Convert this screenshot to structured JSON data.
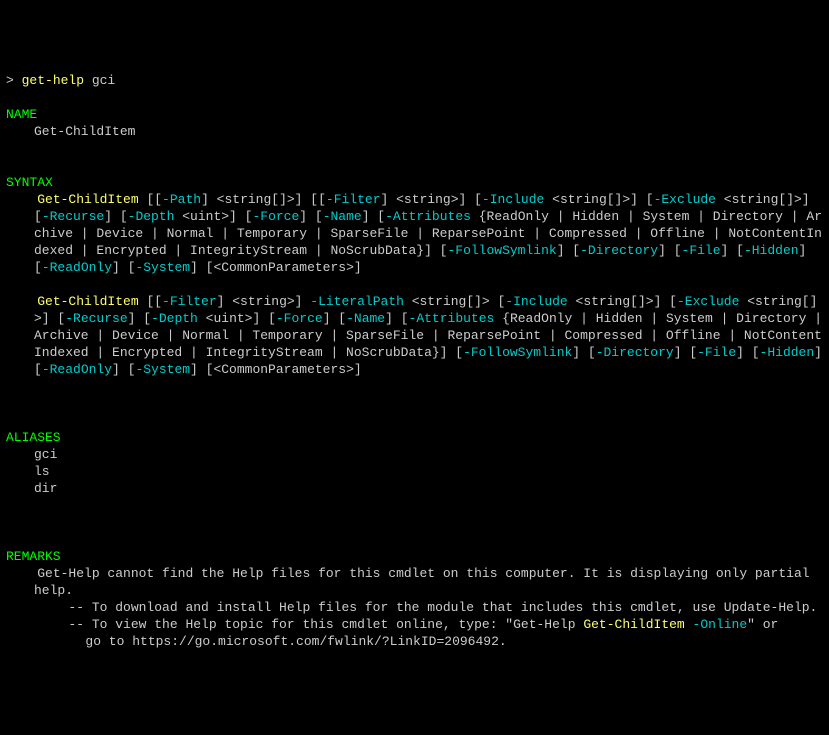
{
  "prompt": {
    "symbol": "> ",
    "command": "get-help ",
    "arg": "gci"
  },
  "sections": {
    "name": {
      "header": "NAME",
      "value": "Get-ChildItem"
    },
    "syntax": {
      "header": "SYNTAX",
      "sig1": {
        "cmd": "Get-ChildItem",
        "path_lb": " [[",
        "path": "-Path",
        "path_rb": "] <string[]>] [[",
        "filter": "-Filter",
        "filter_rb": "] <string>] [",
        "include": "-Include",
        "include_rb": " <string[]>] [",
        "exclude": "-Exclude",
        "exclude_rb": " <string[]>] [",
        "recurse": "-Recurse",
        "recurse_rb": "] [",
        "depth": "-Depth",
        "depth_rb": " <uint>] [",
        "force": "-Force",
        "force_rb": "] [",
        "name_p": "-Name",
        "name_rb": "] [",
        "attrs": "-Attributes",
        "attrs_list": " {ReadOnly | Hidden | System | Directory | Archive | Device | Normal | Temporary | SparseFile | ReparsePoint | Compressed | Offline | NotContentIndexed | Encrypted | IntegrityStream | NoScrubData}] [",
        "follow": "-FollowSymlink",
        "follow_rb": "] [",
        "dir": "-Directory",
        "dir_rb": "] [",
        "file": "-File",
        "file_rb": "] [",
        "hidden": "-Hidden",
        "hidden_rb": "] [",
        "ro": "-ReadOnly",
        "ro_rb": "] [",
        "sys": "-System",
        "sys_rb": "] [<CommonParameters>]"
      },
      "sig2": {
        "cmd": "Get-ChildItem",
        "filter_lb": " [[",
        "filter": "-Filter",
        "filter_rb": "] <string>] ",
        "litpath": "-LiteralPath",
        "litpath_rb": " <string[]> [",
        "include": "-Include",
        "include_rb": " <string[]>] [",
        "exclude": "-Exclude",
        "exclude_rb": " <string[]>] [",
        "recurse": "-Recurse",
        "recurse_rb": "] [",
        "depth": "-Depth",
        "depth_rb": " <uint>] [",
        "force": "-Force",
        "force_rb": "] [",
        "name_p": "-Name",
        "name_rb": "] [",
        "attrs": "-Attributes",
        "attrs_list": " {ReadOnly | Hidden | System | Directory | Archive | Device | Normal | Temporary | SparseFile | ReparsePoint | Compressed | Offline | NotContentIndexed | Encrypted | IntegrityStream | NoScrubData}] [",
        "follow": "-FollowSymlink",
        "follow_rb": "] [",
        "dir": "-Directory",
        "dir_rb": "] [",
        "file": "-File",
        "file_rb": "] [",
        "hidden": "-Hidden",
        "hidden_rb": "] [",
        "ro": "-ReadOnly",
        "ro_rb": "] [",
        "sys": "-System",
        "sys_rb": "] [<CommonParameters>]"
      }
    },
    "aliases": {
      "header": "ALIASES",
      "a1": "gci",
      "a2": "ls",
      "a3": "dir"
    },
    "remarks": {
      "header": "REMARKS",
      "line1": "Get-Help cannot find the Help files for this cmdlet on this computer. It is displaying only partial help.",
      "line2": "-- To download and install Help files for the module that includes this cmdlet, use Update-Help.",
      "line3a": "-- To view the Help topic for this cmdlet online, type: \"Get-Help ",
      "line3b": "Get-ChildItem",
      "line3c": " -Online",
      "line3d": "\" or",
      "line4": "   go to https://go.microsoft.com/fwlink/?LinkID=2096492."
    }
  }
}
